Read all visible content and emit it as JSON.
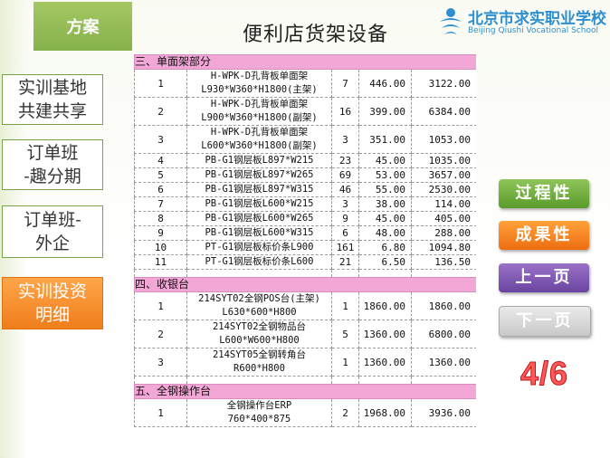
{
  "tab_label": "方案",
  "page_title": "便利店货架设备",
  "logo": {
    "cn": "北京市求实职业学校",
    "en": "Beijing Qiushi Vocational School"
  },
  "sidebar": [
    {
      "line1": "实训基地",
      "line2": "共建共享"
    },
    {
      "line1": "订单班",
      "line2": "-趣分期"
    },
    {
      "line1": "订单班-",
      "line2": "外企"
    },
    {
      "line1": "实训投资",
      "line2": "明细"
    }
  ],
  "table": {
    "sections": [
      {
        "title": "三、单面架部分",
        "rows": [
          {
            "no": "1",
            "name1": "H-WPK-D孔背板单面架",
            "name2": "L930*W360*H1800(主架)",
            "qty": "7",
            "price": "446.00",
            "total": "3122.00"
          },
          {
            "no": "2",
            "name1": "H-WPK-D孔背板单面架",
            "name2": "L900*W360*H1800(副架)",
            "qty": "16",
            "price": "399.00",
            "total": "6384.00"
          },
          {
            "no": "3",
            "name1": "H-WPK-D孔背板单面架",
            "name2": "L600*W360*H1800(副架)",
            "qty": "3",
            "price": "351.00",
            "total": "1053.00"
          },
          {
            "no": "4",
            "name1": "PB-G1钢层板L897*W215",
            "name2": "",
            "qty": "23",
            "price": "45.00",
            "total": "1035.00"
          },
          {
            "no": "5",
            "name1": "PB-G1钢层板L897*W265",
            "name2": "",
            "qty": "69",
            "price": "53.00",
            "total": "3657.00"
          },
          {
            "no": "6",
            "name1": "PB-G1钢层板L897*W315",
            "name2": "",
            "qty": "46",
            "price": "55.00",
            "total": "2530.00"
          },
          {
            "no": "7",
            "name1": "PB-G1钢层板L600*W215",
            "name2": "",
            "qty": "3",
            "price": "38.00",
            "total": "114.00"
          },
          {
            "no": "8",
            "name1": "PB-G1钢层板L600*W265",
            "name2": "",
            "qty": "9",
            "price": "45.00",
            "total": "405.00"
          },
          {
            "no": "9",
            "name1": "PB-G1钢层板L600*W315",
            "name2": "",
            "qty": "6",
            "price": "48.00",
            "total": "288.00"
          },
          {
            "no": "10",
            "name1": "PT-G1钢层板标价条L900",
            "name2": "",
            "qty": "161",
            "price": "6.80",
            "total": "1094.80"
          },
          {
            "no": "11",
            "name1": "PT-G1钢层板标价条L600",
            "name2": "",
            "qty": "21",
            "price": "6.50",
            "total": "136.50"
          }
        ]
      },
      {
        "title": "四、收银台",
        "rows": [
          {
            "no": "1",
            "name1": "214SYT02全钢POS台(主架)",
            "name2": "L630*600*H800",
            "qty": "1",
            "price": "1860.00",
            "total": "1860.00"
          },
          {
            "no": "2",
            "name1": "214SYT02全钢物品台",
            "name2": "L600*W600*H800",
            "qty": "5",
            "price": "1360.00",
            "total": "6800.00"
          },
          {
            "no": "3",
            "name1": "214SYT05全钢转角台",
            "name2": "R600*H800",
            "qty": "1",
            "price": "1360.00",
            "total": "1360.00"
          }
        ]
      },
      {
        "title": "五、全钢操作台",
        "rows": [
          {
            "no": "1",
            "name1": "全钢操作台ERP",
            "name2": "760*400*875",
            "qty": "2",
            "price": "1968.00",
            "total": "3936.00"
          }
        ]
      }
    ]
  },
  "buttons": {
    "process": "过程性",
    "result": "成果性",
    "prev": "上一页",
    "next": "下一页"
  },
  "page_indicator": "4/6",
  "colors": {
    "tab_green": "#86b14a",
    "section_pink": "#f2a7d6",
    "active_orange": "#f07d1b",
    "page_red": "#ff5a5a"
  }
}
